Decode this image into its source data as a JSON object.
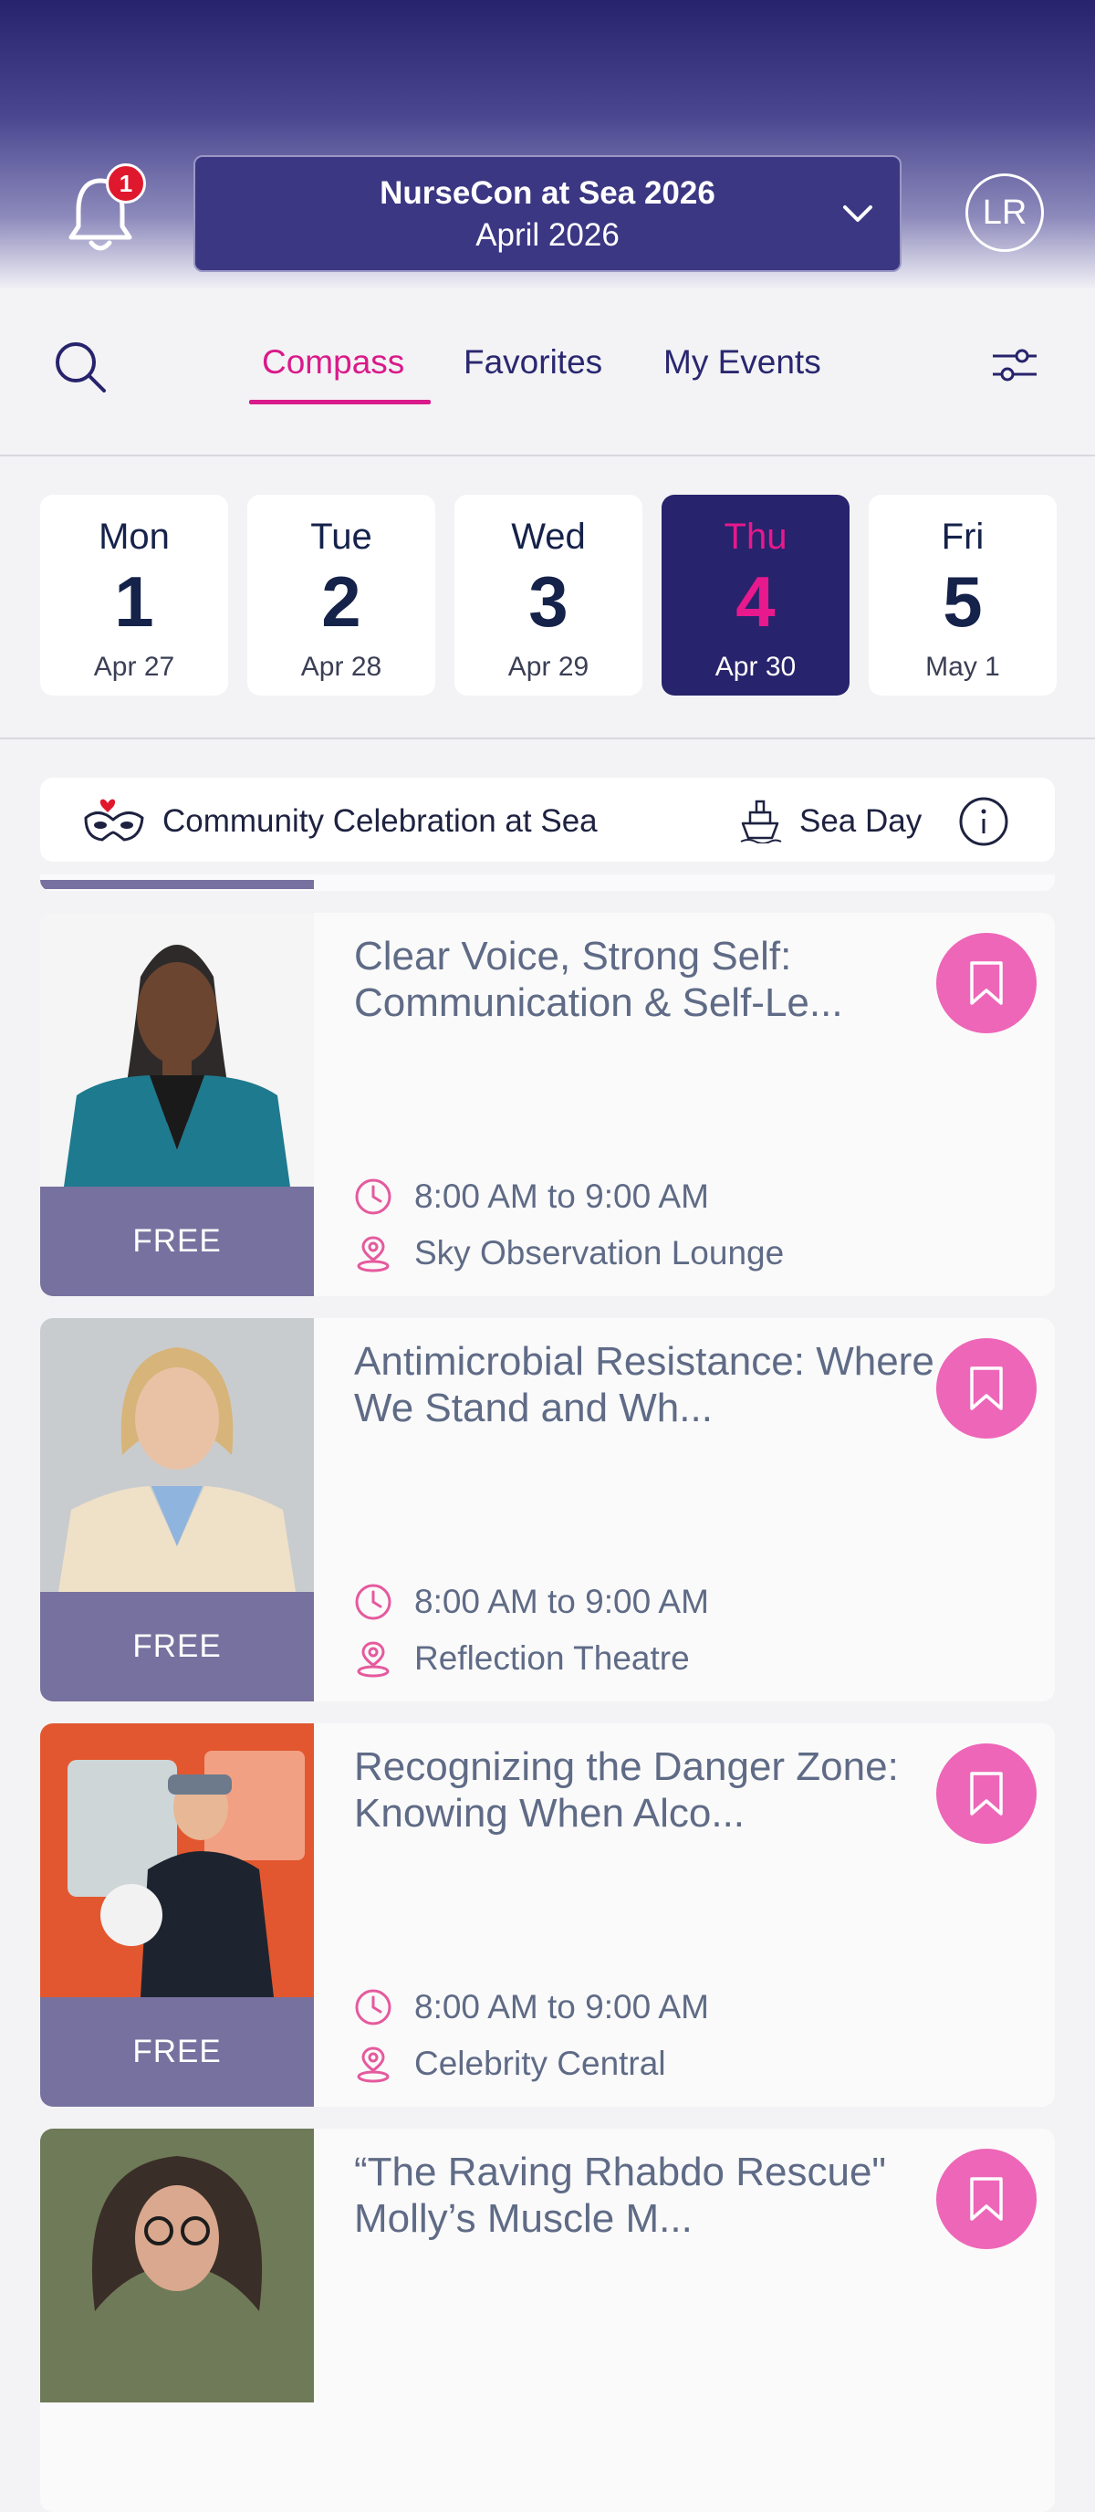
{
  "header": {
    "notification_count": "1",
    "event_name": "NurseCon at Sea 2026",
    "event_date": "April 2026",
    "avatar_initials": "LR"
  },
  "nav": {
    "tabs": [
      {
        "label": "Compass",
        "active": true
      },
      {
        "label": "Favorites",
        "active": false
      },
      {
        "label": "My Events",
        "active": false
      }
    ]
  },
  "days": [
    {
      "dow": "Mon",
      "num": "1",
      "date": "Apr 27",
      "active": false
    },
    {
      "dow": "Tue",
      "num": "2",
      "date": "Apr 28",
      "active": false
    },
    {
      "dow": "Wed",
      "num": "3",
      "date": "Apr 29",
      "active": false
    },
    {
      "dow": "Thu",
      "num": "4",
      "date": "Apr 30",
      "active": true
    },
    {
      "dow": "Fri",
      "num": "5",
      "date": "May 1",
      "active": false
    }
  ],
  "theme": {
    "label": "Community Celebration at Sea",
    "sea_day": "Sea Day"
  },
  "sessions": [
    {
      "title": "Clear Voice, Strong Self: Communication & Self-Le...",
      "time": "8:00 AM to 9:00 AM",
      "location": "Sky Observation Lounge",
      "price": "FREE"
    },
    {
      "title": "Antimicrobial Resistance: Where We Stand and Wh...",
      "time": "8:00 AM to 9:00 AM",
      "location": "Reflection Theatre",
      "price": "FREE"
    },
    {
      "title": "Recognizing the Danger Zone: Knowing When Alco...",
      "time": "8:00 AM to 9:00 AM",
      "location": "Celebrity Central",
      "price": "FREE"
    },
    {
      "title": "“The Raving Rhabdo Rescue\" Molly’s Muscle M...",
      "time": "",
      "location": "",
      "price": ""
    }
  ],
  "colors": {
    "brand_navy": "#27236c",
    "accent_pink": "#e7198d",
    "bookmark_pink": "#ee66b8",
    "price_purple": "#77719f",
    "badge_red": "#e0182d"
  }
}
